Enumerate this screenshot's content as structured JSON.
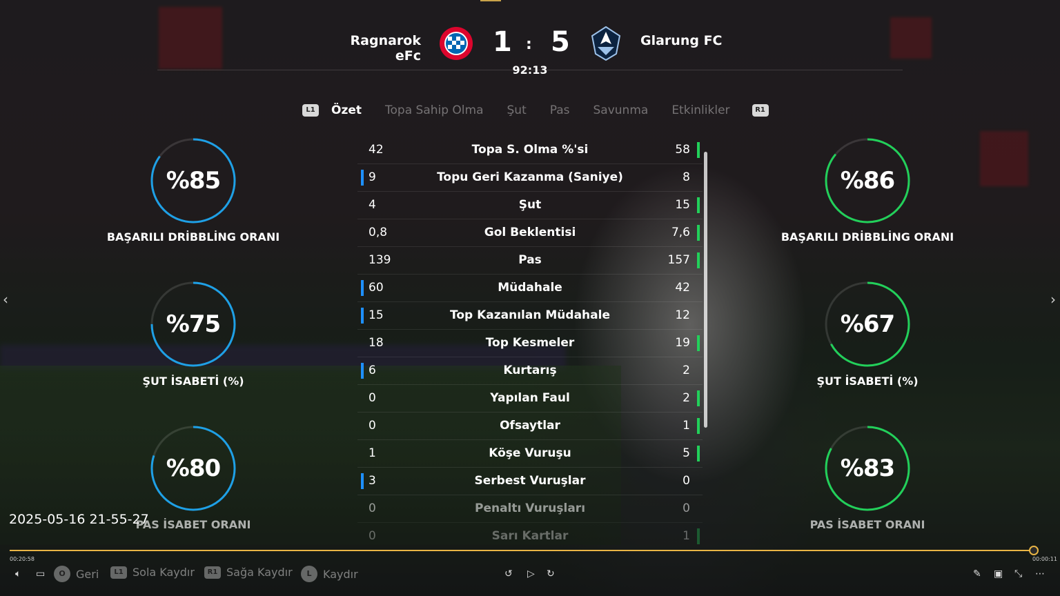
{
  "match": {
    "home_team": "Ragnarok eFc",
    "away_team": "Glarung FC",
    "home_score": "1",
    "away_score": "5",
    "separator": ":",
    "clock": "92:13",
    "home_crest": "fc-bayern-crest",
    "away_crest": "whitecaps-fc-crest"
  },
  "tabs": {
    "left_button": "L1",
    "right_button": "R1",
    "items": [
      {
        "label": "Özet",
        "active": true
      },
      {
        "label": "Topa Sahip Olma",
        "active": false
      },
      {
        "label": "Şut",
        "active": false
      },
      {
        "label": "Pas",
        "active": false
      },
      {
        "label": "Savunma",
        "active": false
      },
      {
        "label": "Etkinlikler",
        "active": false
      }
    ]
  },
  "gauges": {
    "home_color": "#1ea0e6",
    "away_color": "#22d05a",
    "home": [
      {
        "value": "%85",
        "fraction": 0.85,
        "label": "BAŞARILI DRİBBLİNG ORANI"
      },
      {
        "value": "%75",
        "fraction": 0.75,
        "label": "ŞUT İSABETİ (%)"
      },
      {
        "value": "%80",
        "fraction": 0.8,
        "label": "PAS İSABET ORANI"
      }
    ],
    "away": [
      {
        "value": "%86",
        "fraction": 0.86,
        "label": "BAŞARILI DRİBBLİNG ORANI"
      },
      {
        "value": "%67",
        "fraction": 0.67,
        "label": "ŞUT İSABETİ (%)"
      },
      {
        "value": "%83",
        "fraction": 0.83,
        "label": "PAS İSABET ORANI"
      }
    ]
  },
  "stats": [
    {
      "name": "Topa S. Olma %'si",
      "home": "42",
      "away": "58"
    },
    {
      "name": "Topu Geri Kazanma (Saniye)",
      "home": "9",
      "away": "8"
    },
    {
      "name": "Şut",
      "home": "4",
      "away": "15"
    },
    {
      "name": "Gol Beklentisi",
      "home": "0,8",
      "away": "7,6"
    },
    {
      "name": "Pas",
      "home": "139",
      "away": "157"
    },
    {
      "name": "Müdahale",
      "home": "60",
      "away": "42"
    },
    {
      "name": "Top Kazanılan Müdahale",
      "home": "15",
      "away": "12"
    },
    {
      "name": "Top Kesmeler",
      "home": "18",
      "away": "19"
    },
    {
      "name": "Kurtarış",
      "home": "6",
      "away": "2"
    },
    {
      "name": "Yapılan Faul",
      "home": "0",
      "away": "2"
    },
    {
      "name": "Ofsaytlar",
      "home": "0",
      "away": "1"
    },
    {
      "name": "Köşe Vuruşu",
      "home": "1",
      "away": "5"
    },
    {
      "name": "Serbest Vuruşlar",
      "home": "3",
      "away": "0"
    },
    {
      "name": "Penaltı Vuruşları",
      "home": "0",
      "away": "0"
    },
    {
      "name": "Sarı Kartlar",
      "home": "0",
      "away": "1"
    }
  ],
  "overlay": {
    "timestamp": "2025-05-16 21-55-27"
  },
  "player": {
    "time_elapsed": "00:20:58",
    "time_remaining": "00:00:11",
    "progress": 0.995,
    "accent_color": "#e9b545",
    "controls": [
      {
        "badge": "O",
        "label": "Geri",
        "icon": "circle-button-icon"
      },
      {
        "badge": "L1",
        "label": "Sola Kaydır",
        "icon": "l1-button-icon"
      },
      {
        "badge": "R1",
        "label": "Sağa Kaydır",
        "icon": "r1-button-icon"
      },
      {
        "badge": "L",
        "label": "Kaydır",
        "icon": "left-stick-icon"
      }
    ]
  }
}
